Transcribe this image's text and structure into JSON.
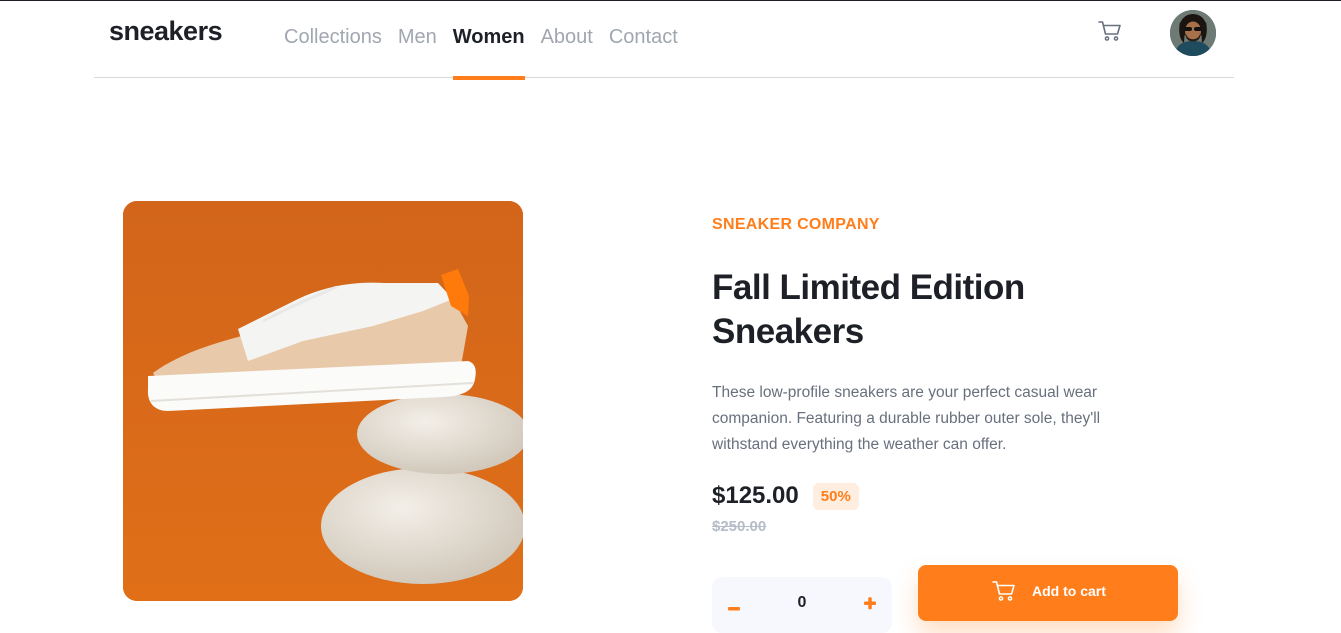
{
  "header": {
    "logo": "sneakers",
    "nav": [
      {
        "label": "Collections",
        "active": false
      },
      {
        "label": "Men",
        "active": false
      },
      {
        "label": "Women",
        "active": true
      },
      {
        "label": "About",
        "active": false
      },
      {
        "label": "Contact",
        "active": false
      }
    ],
    "cart_icon": "cart-icon",
    "avatar_icon": "user-avatar"
  },
  "product": {
    "company": "SNEAKER COMPANY",
    "title": "Fall Limited Edition Sneakers",
    "description": "These low-profile sneakers are your perfect casual wear companion. Featuring a durable rubber outer sole, they'll withstand everything the weather can offer.",
    "price": "$125.00",
    "discount": "50%",
    "original_price": "$250.00",
    "image": "sneaker-on-stones-photo"
  },
  "cart_controls": {
    "quantity": "0",
    "minus_icon": "minus-icon",
    "plus_icon": "plus-icon",
    "add_label": "Add to cart",
    "add_icon": "cart-icon"
  },
  "colors": {
    "accent": "#ff7e1b",
    "accent_pale": "#ffede0",
    "text_dark": "#1d2026",
    "text_gray": "#68707d",
    "nav_gray": "#a1a6b0",
    "stepper_bg": "#f6f8fd"
  }
}
